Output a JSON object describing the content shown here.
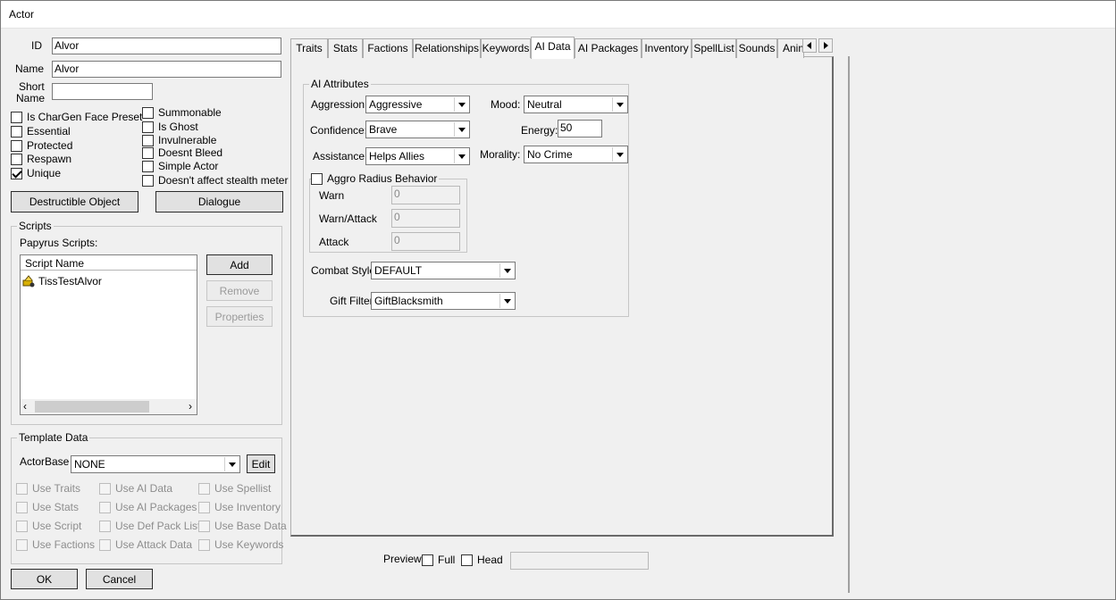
{
  "window": {
    "title": "Actor"
  },
  "left": {
    "id_label": "ID",
    "id_value": "Alvor",
    "name_label": "Name",
    "name_value": "Alvor",
    "short_name_label_1": "Short",
    "short_name_label_2": "Name",
    "short_name_value": "",
    "flags_left": [
      {
        "label": "Is CharGen Face Preset",
        "checked": false
      },
      {
        "label": "Essential",
        "checked": false
      },
      {
        "label": "Protected",
        "checked": false
      },
      {
        "label": "Respawn",
        "checked": false
      },
      {
        "label": "Unique",
        "checked": true
      }
    ],
    "flags_right": [
      {
        "label": "Summonable",
        "checked": false
      },
      {
        "label": "Is Ghost",
        "checked": false
      },
      {
        "label": "Invulnerable",
        "checked": false
      },
      {
        "label": "Doesnt Bleed",
        "checked": false
      },
      {
        "label": "Simple Actor",
        "checked": false
      },
      {
        "label": "Doesn't affect stealth meter",
        "checked": false
      }
    ],
    "destructible_button": "Destructible Object",
    "dialogue_button": "Dialogue"
  },
  "scripts": {
    "group_title": "Scripts",
    "papyrus_label": "Papyrus Scripts:",
    "column_header": "Script Name",
    "items": [
      "TissTestAlvor"
    ],
    "add_button": "Add",
    "remove_button": "Remove",
    "properties_button": "Properties"
  },
  "template": {
    "group_title": "Template Data",
    "actorbase_label": "ActorBase",
    "actorbase_value": "NONE",
    "edit_button": "Edit",
    "col1": [
      "Use Traits",
      "Use Stats",
      "Use Script",
      "Use Factions"
    ],
    "col2": [
      "Use AI Data",
      "Use AI Packages",
      "Use Def Pack List",
      "Use Attack Data"
    ],
    "col3": [
      "Use Spellist",
      "Use Inventory",
      "Use Base Data",
      "Use Keywords"
    ]
  },
  "footer": {
    "ok_button": "OK",
    "cancel_button": "Cancel",
    "preview_label": "Preview",
    "full_label": "Full",
    "head_label": "Head",
    "preview_value": ""
  },
  "tabs": [
    "Traits",
    "Stats",
    "Factions",
    "Relationships",
    "Keywords",
    "AI Data",
    "AI Packages",
    "Inventory",
    "SpellList",
    "Sounds",
    "Anim"
  ],
  "active_tab": "AI Data",
  "ai": {
    "group_title": "AI Attributes",
    "aggression_label": "Aggression:",
    "aggression_value": "Aggressive",
    "mood_label": "Mood:",
    "mood_value": "Neutral",
    "confidence_label": "Confidence:",
    "confidence_value": "Brave",
    "energy_label": "Energy:",
    "energy_value": "50",
    "assistance_label": "Assistance:",
    "assistance_value": "Helps Allies",
    "morality_label": "Morality:",
    "morality_value": "No Crime",
    "aggro_title": "Aggro Radius Behavior",
    "warn_label": "Warn",
    "warn_value": "0",
    "warn_attack_label": "Warn/Attack",
    "warn_attack_value": "0",
    "attack_label": "Attack",
    "attack_value": "0",
    "combat_style_label": "Combat Style",
    "combat_style_value": "DEFAULT",
    "gift_filter_label": "Gift Filter",
    "gift_filter_value": "GiftBlacksmith"
  }
}
